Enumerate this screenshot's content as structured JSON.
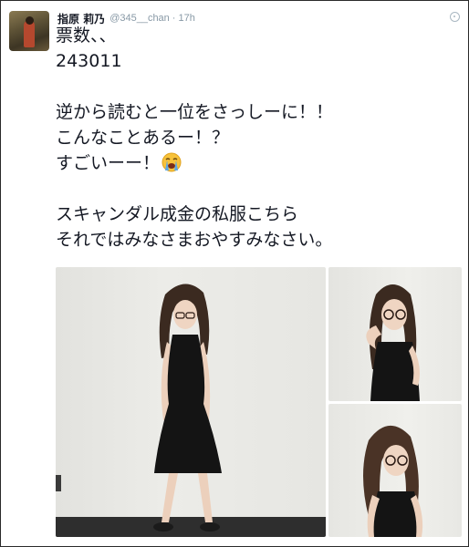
{
  "tweet": {
    "display_name": "指原 莉乃",
    "handle": "@345__chan",
    "separator": "·",
    "time": "17h",
    "lines": [
      "票数、、",
      "243011",
      "",
      "逆から読むと一位をさっしーに！！",
      "こんなことあるー！？",
      "すごいーー！",
      "",
      "スキャンダル成金の私服こちら",
      "それではみなさまおやすみなさい。"
    ],
    "emoji_icon": "loudly-crying-face-icon"
  },
  "media": {
    "photos": [
      "photo-main",
      "photo-top-right",
      "photo-bottom-right"
    ]
  },
  "colors": {
    "text": "#141823",
    "meta": "#8899a6",
    "dress": "#141414",
    "hair": "#3b2a20"
  }
}
